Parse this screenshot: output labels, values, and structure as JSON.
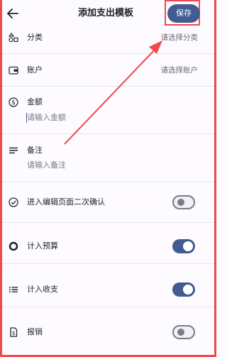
{
  "header": {
    "title": "添加支出模板",
    "save_label": "保存",
    "icons": {
      "back": "arrow-left-icon"
    }
  },
  "rows": {
    "category": {
      "label": "分类",
      "value": "请选择分类",
      "icon": "category-shapes-icon"
    },
    "account": {
      "label": "账户",
      "value": "请选择账户",
      "icon": "wallet-icon"
    },
    "amount": {
      "label": "金额",
      "placeholder": "请输入金额",
      "icon": "dollar-circle-icon"
    },
    "note": {
      "label": "备注",
      "placeholder": "请输入备注",
      "icon": "notes-lines-icon"
    },
    "confirm_edit": {
      "label": "进入编辑页面二次确认",
      "on": false,
      "icon": "check-circle-icon"
    },
    "budget": {
      "label": "计入预算",
      "on": true,
      "icon": "ring-icon"
    },
    "income_expense": {
      "label": "计入收支",
      "on": true,
      "icon": "list-icon"
    },
    "reimburse": {
      "label": "报销",
      "on": false,
      "icon": "receipt-dollar-icon"
    }
  },
  "colors": {
    "accent": "#435b92",
    "annotation": "#f0494d",
    "background": "#fdfbff"
  }
}
